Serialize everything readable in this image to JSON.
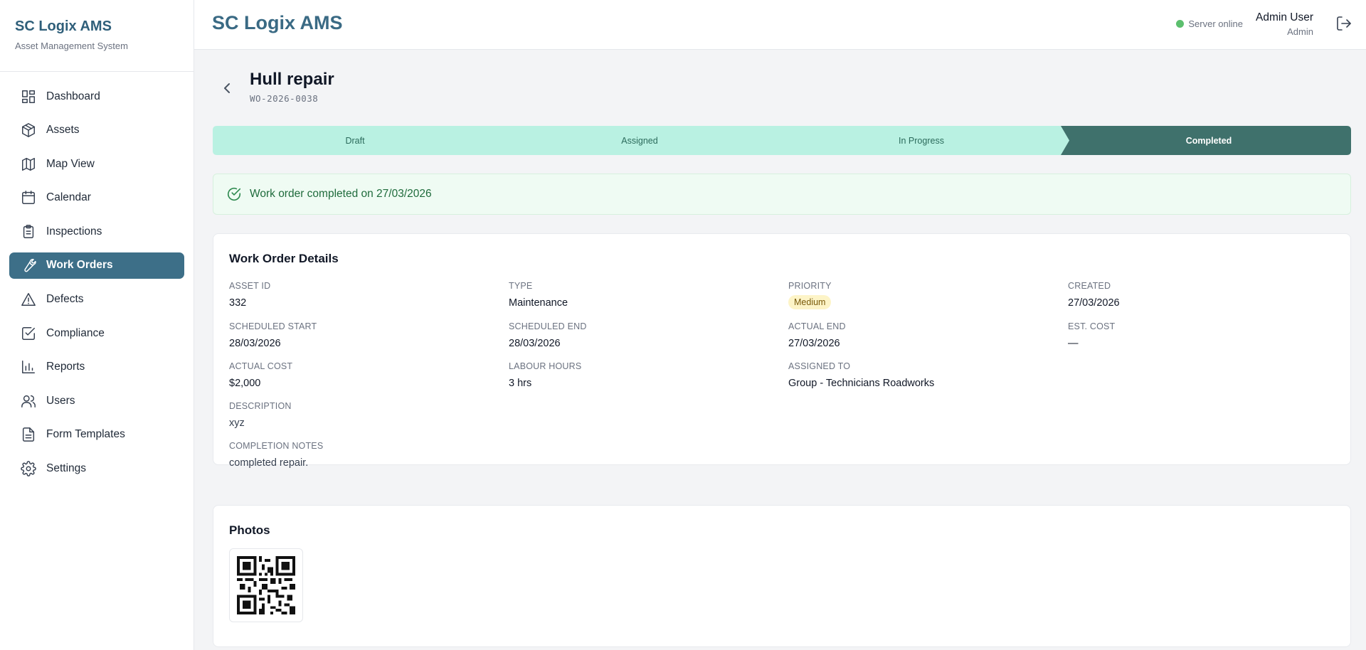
{
  "brand": {
    "title": "SC Logix AMS",
    "subtitle": "Asset Management System"
  },
  "sidebar": {
    "items": [
      {
        "label": "Dashboard",
        "icon": "dashboard-icon"
      },
      {
        "label": "Assets",
        "icon": "box-icon"
      },
      {
        "label": "Map View",
        "icon": "map-icon"
      },
      {
        "label": "Calendar",
        "icon": "calendar-icon"
      },
      {
        "label": "Inspections",
        "icon": "clipboard-icon"
      },
      {
        "label": "Work Orders",
        "icon": "wrench-icon",
        "active": true
      },
      {
        "label": "Defects",
        "icon": "warning-triangle-icon"
      },
      {
        "label": "Compliance",
        "icon": "checkbox-icon"
      },
      {
        "label": "Reports",
        "icon": "bar-chart-icon"
      },
      {
        "label": "Users",
        "icon": "users-icon"
      },
      {
        "label": "Form Templates",
        "icon": "document-icon"
      },
      {
        "label": "Settings",
        "icon": "gear-icon"
      }
    ]
  },
  "header": {
    "title": "SC Logix AMS",
    "server_status": "Server online",
    "user_name": "Admin User",
    "user_role": "Admin"
  },
  "work_order": {
    "title": "Hull repair",
    "number": "WO-2026-0038",
    "steps": [
      "Draft",
      "Assigned",
      "In Progress",
      "Completed"
    ],
    "current_step": "Completed",
    "banner": "Work order completed on 27/03/2026"
  },
  "details": {
    "title": "Work Order Details",
    "asset_id": {
      "label": "ASSET ID",
      "value": "332"
    },
    "type": {
      "label": "TYPE",
      "value": "Maintenance"
    },
    "priority": {
      "label": "PRIORITY",
      "value": "Medium"
    },
    "created": {
      "label": "CREATED",
      "value": "27/03/2026"
    },
    "scheduled_start": {
      "label": "SCHEDULED START",
      "value": "28/03/2026"
    },
    "scheduled_end": {
      "label": "SCHEDULED END",
      "value": "28/03/2026"
    },
    "actual_end": {
      "label": "ACTUAL END",
      "value": "27/03/2026"
    },
    "est_cost": {
      "label": "EST. COST",
      "value": "—"
    },
    "actual_cost": {
      "label": "ACTUAL COST",
      "value": "$2,000"
    },
    "labour_hours": {
      "label": "LABOUR HOURS",
      "value": "3 hrs"
    },
    "assigned_to": {
      "label": "ASSIGNED TO",
      "value": "Group - Technicians Roadworks"
    },
    "description": {
      "label": "DESCRIPTION",
      "value": "xyz"
    },
    "completion_notes": {
      "label": "COMPLETION NOTES",
      "value": "completed repair."
    }
  },
  "photos": {
    "title": "Photos"
  },
  "colors": {
    "brand": "#3a6a84",
    "active_nav": "#3d6f88",
    "step_pending": "#b9f1e2",
    "step_done": "#3f716c",
    "success_bg": "#effbf3",
    "priority_badge": "#fdf4c7",
    "online": "#5cbf6e"
  }
}
